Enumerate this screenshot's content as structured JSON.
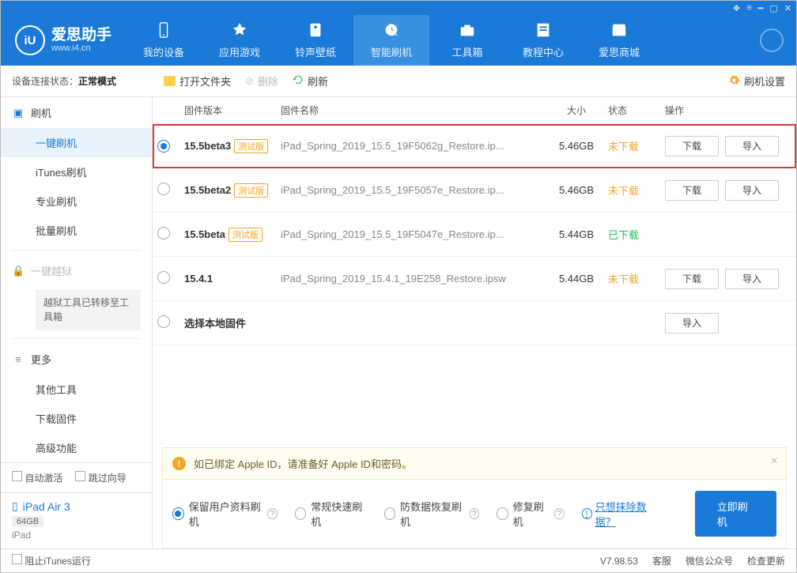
{
  "brand": {
    "cn": "爱思助手",
    "url": "www.i4.cn",
    "logo_text": "iU"
  },
  "nav": [
    {
      "label": "我的设备"
    },
    {
      "label": "应用游戏"
    },
    {
      "label": "铃声壁纸"
    },
    {
      "label": "智能刷机",
      "active": true
    },
    {
      "label": "工具箱"
    },
    {
      "label": "教程中心"
    },
    {
      "label": "爱思商城"
    }
  ],
  "conn": {
    "label": "设备连接状态：",
    "value": "正常模式"
  },
  "toolbar": {
    "open_folder": "打开文件夹",
    "delete": "删除",
    "refresh": "刷新",
    "settings": "刷机设置"
  },
  "sidebar": {
    "sec1_title": "刷机",
    "items1": [
      "一键刷机",
      "iTunes刷机",
      "专业刷机",
      "批量刷机"
    ],
    "jailbreak": "一键越狱",
    "jailbreak_note": "越狱工具已转移至工具箱",
    "sec2_title": "更多",
    "items2": [
      "其他工具",
      "下载固件",
      "高级功能"
    ],
    "check_auto": "自动激活",
    "check_skip": "跳过向导",
    "device_name": "iPad Air 3",
    "device_storage": "64GB",
    "device_type": "iPad"
  },
  "columns": {
    "version": "固件版本",
    "name": "固件名称",
    "size": "大小",
    "status": "状态",
    "ops": "操作"
  },
  "beta_tag": "测试版",
  "rows": [
    {
      "version": "15.5beta3",
      "beta": true,
      "name": "iPad_Spring_2019_15.5_19F5062g_Restore.ip...",
      "size": "5.46GB",
      "status": "未下载",
      "status_cls": "not",
      "selected": true,
      "highlight": true,
      "dl": true,
      "imp": true
    },
    {
      "version": "15.5beta2",
      "beta": true,
      "name": "iPad_Spring_2019_15.5_19F5057e_Restore.ip...",
      "size": "5.46GB",
      "status": "未下载",
      "status_cls": "not",
      "dl": true,
      "imp": true
    },
    {
      "version": "15.5beta",
      "beta": true,
      "name": "iPad_Spring_2019_15.5_19F5047e_Restore.ip...",
      "size": "5.44GB",
      "status": "已下载",
      "status_cls": "done"
    },
    {
      "version": "15.4.1",
      "beta": false,
      "name": "iPad_Spring_2019_15.4.1_19E258_Restore.ipsw",
      "size": "5.44GB",
      "status": "未下载",
      "status_cls": "not",
      "dl": true,
      "imp": true
    },
    {
      "version": "选择本地固件",
      "beta": false,
      "name": "",
      "size": "",
      "status": "",
      "status_cls": "",
      "imp": true
    }
  ],
  "btn": {
    "download": "下载",
    "import": "导入"
  },
  "tip": "如已绑定 Apple ID，请准备好 Apple ID和密码。",
  "flash_opts": [
    "保留用户资料刷机",
    "常规快速刷机",
    "防数据恢复刷机",
    "修复刷机"
  ],
  "erase_link": "只想抹除数据？",
  "flash_now": "立即刷机",
  "status": {
    "block_itunes": "阻止iTunes运行",
    "version": "V7.98.53",
    "kefu": "客服",
    "wechat": "微信公众号",
    "update": "检查更新"
  }
}
